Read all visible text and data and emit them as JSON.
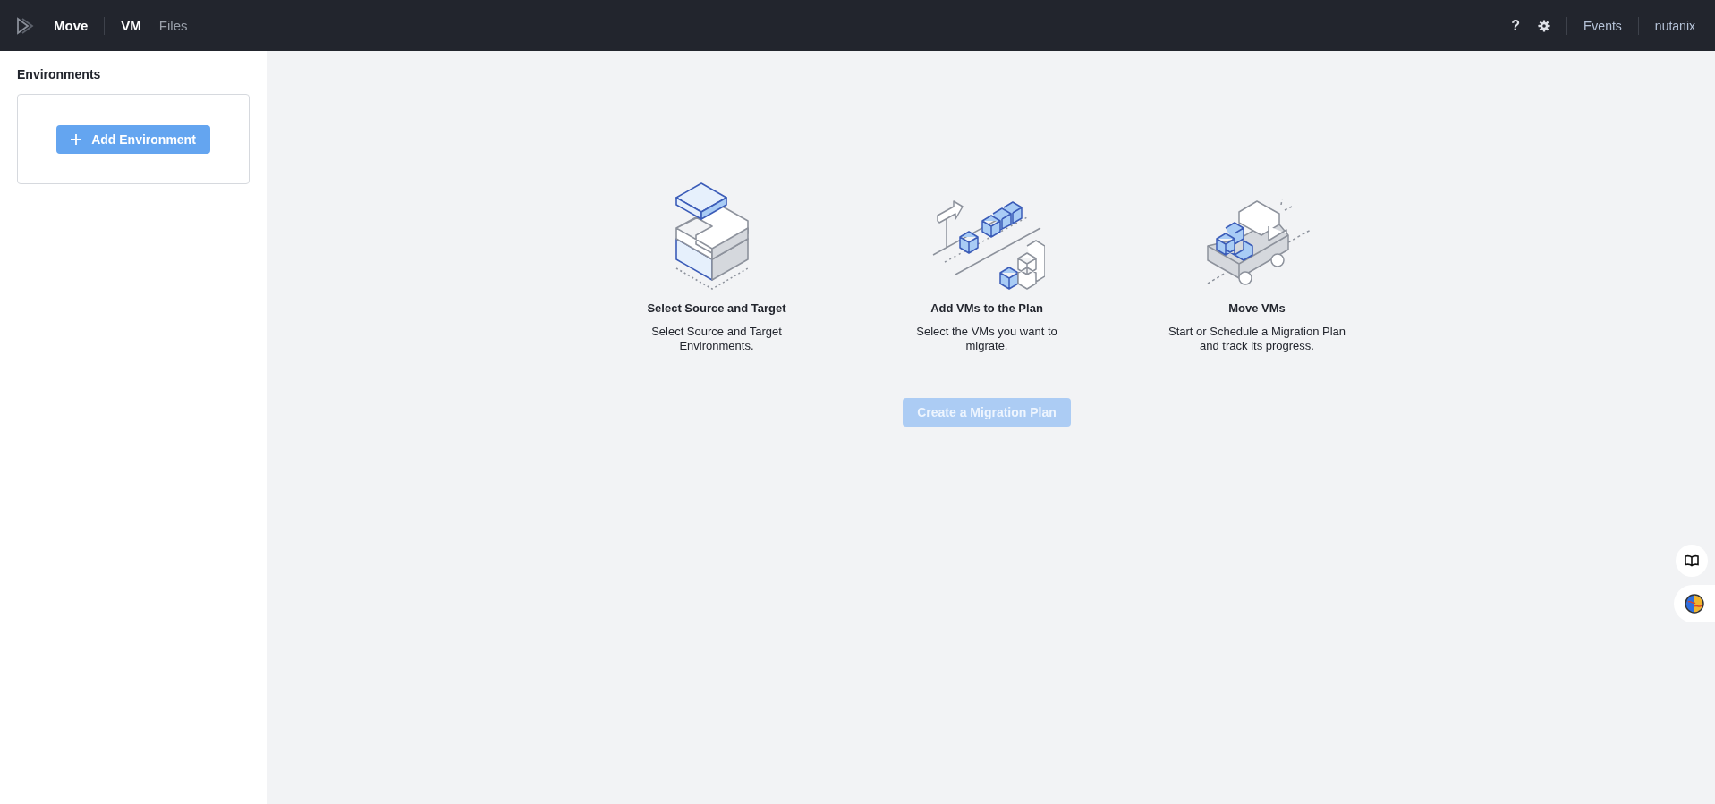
{
  "header": {
    "app_name": "Move",
    "tabs": [
      {
        "label": "VM",
        "selected": true
      },
      {
        "label": "Files",
        "selected": false
      }
    ],
    "help": "?",
    "links": [
      "Events",
      "nutanix"
    ]
  },
  "sidebar": {
    "title": "Environments",
    "add_button": "Add Environment"
  },
  "steps": [
    {
      "kind": "source-target",
      "title": "Select Source and Target",
      "description": "Select Source and Target Environments."
    },
    {
      "kind": "add-vms",
      "title": "Add VMs to the Plan",
      "description": "Select the VMs you want to migrate."
    },
    {
      "kind": "move",
      "title": "Move VMs",
      "description": "Start or Schedule a Migration Plan and track its progress."
    }
  ],
  "create_button": {
    "label": "Create a Migration Plan",
    "disabled": true
  }
}
